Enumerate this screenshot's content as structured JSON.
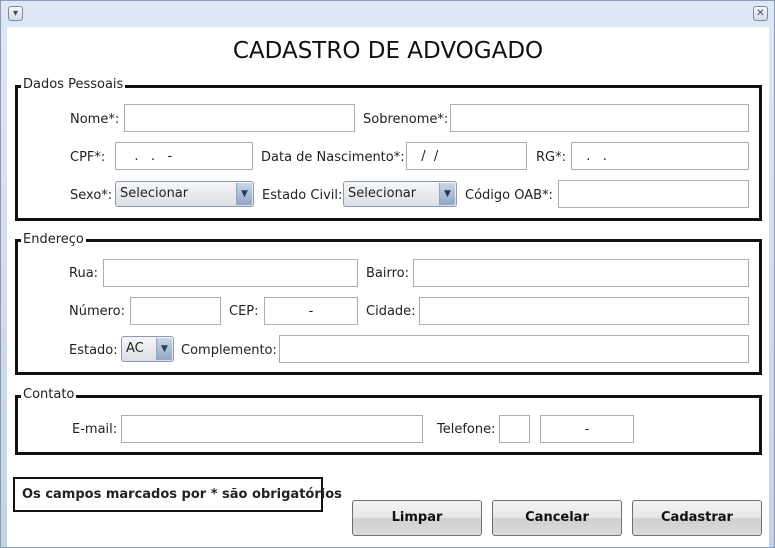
{
  "titlebar": {
    "menu_glyph": "▾",
    "close_glyph": "✕"
  },
  "form": {
    "title": "CADASTRO DE ADVOGADO",
    "dados_pessoais": {
      "legend": "Dados Pessoais",
      "nome_label": "Nome*:",
      "nome_value": "",
      "sobrenome_label": "Sobrenome*:",
      "sobrenome_value": "",
      "cpf_label": "CPF*:",
      "cpf_value": "   .   .   -",
      "nascimento_label": "Data de Nascimento*:",
      "nascimento_value": "  /  /",
      "rg_label": "RG*:",
      "rg_value": "  .   .",
      "sexo_label": "Sexo*:",
      "sexo_value": "Selecionar",
      "estado_civil_label": "Estado Civil:",
      "estado_civil_value": "Selecionar",
      "oab_label": "Código OAB*:",
      "oab_value": ""
    },
    "endereco": {
      "legend": "Endereço",
      "rua_label": "Rua:",
      "rua_value": "",
      "bairro_label": "Bairro:",
      "bairro_value": "",
      "numero_label": "Número:",
      "numero_value": "",
      "cep_label": "CEP:",
      "cep_value": "-",
      "cidade_label": "Cidade:",
      "cidade_value": "",
      "estado_label": "Estado:",
      "estado_value": "AC",
      "complemento_label": "Complemento:",
      "complemento_value": ""
    },
    "contato": {
      "legend": "Contato",
      "email_label": "E-mail:",
      "email_value": "",
      "telefone_label": "Telefone:",
      "ddd_value": "",
      "telefone_value": "-"
    },
    "required_note": "Os campos marcados por * são obrigatórios",
    "buttons": {
      "limpar": "Limpar",
      "cancelar": "Cancelar",
      "cadastrar": "Cadastrar"
    }
  },
  "colors": {
    "window_frame": "#c5d3e6",
    "combo_arrow": "#8fa6c6",
    "group_border": "#111111"
  },
  "icons": {
    "menu": "chevron-down-icon",
    "close": "close-icon",
    "combo": "dropdown-arrow-icon"
  }
}
